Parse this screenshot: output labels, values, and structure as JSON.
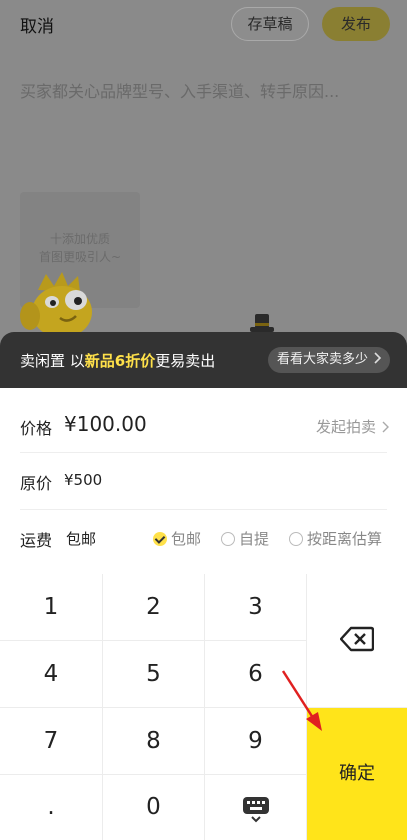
{
  "header": {
    "cancel_label": "取消",
    "draft_label": "存草稿",
    "publish_label": "发布"
  },
  "description": {
    "placeholder": "买家都关心品牌型号、入手渠道、转手原因..."
  },
  "photo": {
    "add_line1": "十添加优质",
    "add_line2": "首图更吸引人~"
  },
  "promo": {
    "text_prefix": "卖闲置 以",
    "highlight": "新品6折价",
    "text_suffix": "更易卖出",
    "link_label": "看看大家卖多少"
  },
  "price": {
    "label": "价格",
    "value": "¥100.00",
    "auction_label": "发起拍卖"
  },
  "original_price": {
    "label": "原价",
    "value": "¥500"
  },
  "shipping": {
    "label": "运费",
    "value": "包邮",
    "options": [
      "包邮",
      "自提",
      "按距离估算"
    ],
    "selected": "包邮"
  },
  "keypad": {
    "keys": [
      "1",
      "2",
      "3",
      "4",
      "5",
      "6",
      "7",
      "8",
      "9",
      ".",
      "0"
    ],
    "confirm_label": "确定",
    "delete_icon": "backspace-icon",
    "keyboard_icon": "keyboard-icon"
  },
  "colors": {
    "accent": "#ffe41a",
    "overlay": "#8a8a8a",
    "banner": "#333333",
    "annotation_arrow": "#e02020"
  }
}
